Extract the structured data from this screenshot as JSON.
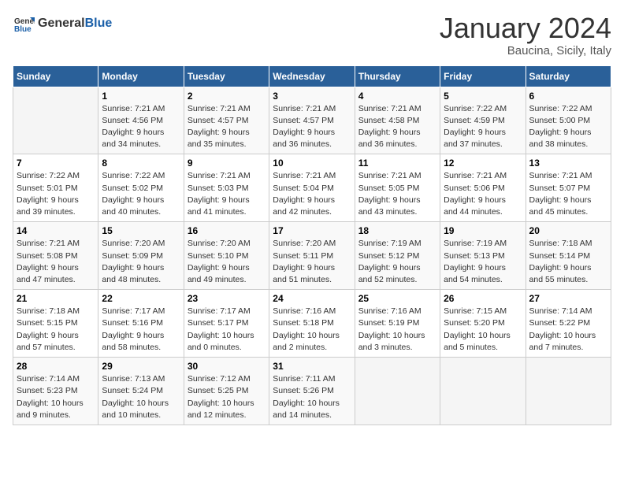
{
  "header": {
    "logo_general": "General",
    "logo_blue": "Blue",
    "title": "January 2024",
    "subtitle": "Baucina, Sicily, Italy"
  },
  "columns": [
    "Sunday",
    "Monday",
    "Tuesday",
    "Wednesday",
    "Thursday",
    "Friday",
    "Saturday"
  ],
  "weeks": [
    [
      {
        "num": "",
        "info": ""
      },
      {
        "num": "1",
        "info": "Sunrise: 7:21 AM\nSunset: 4:56 PM\nDaylight: 9 hours\nand 34 minutes."
      },
      {
        "num": "2",
        "info": "Sunrise: 7:21 AM\nSunset: 4:57 PM\nDaylight: 9 hours\nand 35 minutes."
      },
      {
        "num": "3",
        "info": "Sunrise: 7:21 AM\nSunset: 4:57 PM\nDaylight: 9 hours\nand 36 minutes."
      },
      {
        "num": "4",
        "info": "Sunrise: 7:21 AM\nSunset: 4:58 PM\nDaylight: 9 hours\nand 36 minutes."
      },
      {
        "num": "5",
        "info": "Sunrise: 7:22 AM\nSunset: 4:59 PM\nDaylight: 9 hours\nand 37 minutes."
      },
      {
        "num": "6",
        "info": "Sunrise: 7:22 AM\nSunset: 5:00 PM\nDaylight: 9 hours\nand 38 minutes."
      }
    ],
    [
      {
        "num": "7",
        "info": "Sunrise: 7:22 AM\nSunset: 5:01 PM\nDaylight: 9 hours\nand 39 minutes."
      },
      {
        "num": "8",
        "info": "Sunrise: 7:22 AM\nSunset: 5:02 PM\nDaylight: 9 hours\nand 40 minutes."
      },
      {
        "num": "9",
        "info": "Sunrise: 7:21 AM\nSunset: 5:03 PM\nDaylight: 9 hours\nand 41 minutes."
      },
      {
        "num": "10",
        "info": "Sunrise: 7:21 AM\nSunset: 5:04 PM\nDaylight: 9 hours\nand 42 minutes."
      },
      {
        "num": "11",
        "info": "Sunrise: 7:21 AM\nSunset: 5:05 PM\nDaylight: 9 hours\nand 43 minutes."
      },
      {
        "num": "12",
        "info": "Sunrise: 7:21 AM\nSunset: 5:06 PM\nDaylight: 9 hours\nand 44 minutes."
      },
      {
        "num": "13",
        "info": "Sunrise: 7:21 AM\nSunset: 5:07 PM\nDaylight: 9 hours\nand 45 minutes."
      }
    ],
    [
      {
        "num": "14",
        "info": "Sunrise: 7:21 AM\nSunset: 5:08 PM\nDaylight: 9 hours\nand 47 minutes."
      },
      {
        "num": "15",
        "info": "Sunrise: 7:20 AM\nSunset: 5:09 PM\nDaylight: 9 hours\nand 48 minutes."
      },
      {
        "num": "16",
        "info": "Sunrise: 7:20 AM\nSunset: 5:10 PM\nDaylight: 9 hours\nand 49 minutes."
      },
      {
        "num": "17",
        "info": "Sunrise: 7:20 AM\nSunset: 5:11 PM\nDaylight: 9 hours\nand 51 minutes."
      },
      {
        "num": "18",
        "info": "Sunrise: 7:19 AM\nSunset: 5:12 PM\nDaylight: 9 hours\nand 52 minutes."
      },
      {
        "num": "19",
        "info": "Sunrise: 7:19 AM\nSunset: 5:13 PM\nDaylight: 9 hours\nand 54 minutes."
      },
      {
        "num": "20",
        "info": "Sunrise: 7:18 AM\nSunset: 5:14 PM\nDaylight: 9 hours\nand 55 minutes."
      }
    ],
    [
      {
        "num": "21",
        "info": "Sunrise: 7:18 AM\nSunset: 5:15 PM\nDaylight: 9 hours\nand 57 minutes."
      },
      {
        "num": "22",
        "info": "Sunrise: 7:17 AM\nSunset: 5:16 PM\nDaylight: 9 hours\nand 58 minutes."
      },
      {
        "num": "23",
        "info": "Sunrise: 7:17 AM\nSunset: 5:17 PM\nDaylight: 10 hours\nand 0 minutes."
      },
      {
        "num": "24",
        "info": "Sunrise: 7:16 AM\nSunset: 5:18 PM\nDaylight: 10 hours\nand 2 minutes."
      },
      {
        "num": "25",
        "info": "Sunrise: 7:16 AM\nSunset: 5:19 PM\nDaylight: 10 hours\nand 3 minutes."
      },
      {
        "num": "26",
        "info": "Sunrise: 7:15 AM\nSunset: 5:20 PM\nDaylight: 10 hours\nand 5 minutes."
      },
      {
        "num": "27",
        "info": "Sunrise: 7:14 AM\nSunset: 5:22 PM\nDaylight: 10 hours\nand 7 minutes."
      }
    ],
    [
      {
        "num": "28",
        "info": "Sunrise: 7:14 AM\nSunset: 5:23 PM\nDaylight: 10 hours\nand 9 minutes."
      },
      {
        "num": "29",
        "info": "Sunrise: 7:13 AM\nSunset: 5:24 PM\nDaylight: 10 hours\nand 10 minutes."
      },
      {
        "num": "30",
        "info": "Sunrise: 7:12 AM\nSunset: 5:25 PM\nDaylight: 10 hours\nand 12 minutes."
      },
      {
        "num": "31",
        "info": "Sunrise: 7:11 AM\nSunset: 5:26 PM\nDaylight: 10 hours\nand 14 minutes."
      },
      {
        "num": "",
        "info": ""
      },
      {
        "num": "",
        "info": ""
      },
      {
        "num": "",
        "info": ""
      }
    ]
  ]
}
